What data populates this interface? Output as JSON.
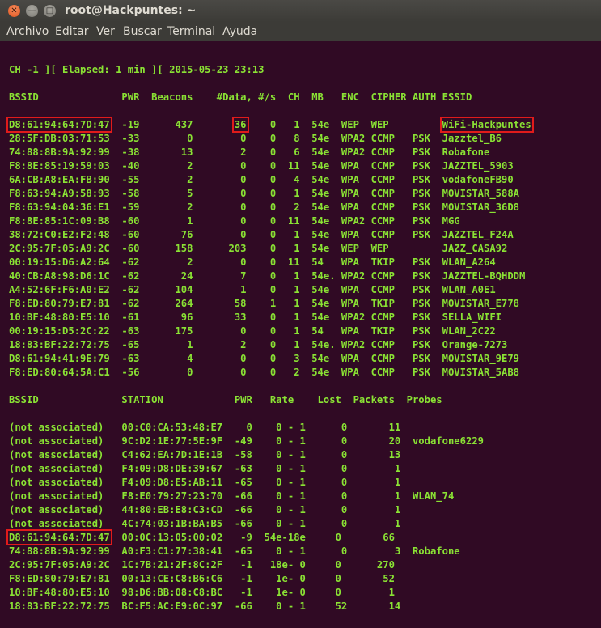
{
  "window": {
    "title": "root@Hackpuntes: ~",
    "close_glyph": "✕",
    "min_glyph": "—",
    "max_glyph": "□"
  },
  "menu": [
    "Archivo",
    "Editar",
    "Ver",
    "Buscar",
    "Terminal",
    "Ayuda"
  ],
  "colors": {
    "terminal_bg": "#300a24",
    "terminal_text": "#8ae234",
    "highlight_box": "#e01b1b"
  },
  "terminal": {
    "lines": [
      "",
      "CH -1 ][ Elapsed: 1 min ][ 2015-05-23 23:13",
      "",
      "BSSID              PWR  Beacons    #Data, #/s  CH  MB   ENC  CIPHER AUTH ESSID",
      "",
      "D8:61:94:64:7D:47  -19      437       36    0   1  54e  WEP  WEP         WiFi-Hackpuntes",
      "28:5F:DB:03:71:53  -33        0        0    0   8  54e  WPA2 CCMP   PSK  Jazztel_B6",
      "74:88:8B:9A:92:99  -38       13        2    0   6  54e  WPA2 CCMP   PSK  Robafone",
      "F8:8E:85:19:59:03  -40        2        0    0  11  54e  WPA  CCMP   PSK  JAZZTEL_5903",
      "6A:CB:A8:EA:FB:90  -55        2        0    0   4  54e  WPA  CCMP   PSK  vodafoneFB90",
      "F8:63:94:A9:58:93  -58        5        0    0   1  54e  WPA  CCMP   PSK  MOVISTAR_588A",
      "F8:63:94:04:36:E1  -59        2        0    0   2  54e  WPA  CCMP   PSK  MOVISTAR_36D8",
      "F8:8E:85:1C:09:B8  -60        1        0    0  11  54e  WPA2 CCMP   PSK  MGG",
      "38:72:C0:E2:F2:48  -60       76        0    0   1  54e  WPA  CCMP   PSK  JAZZTEL_F24A",
      "2C:95:7F:05:A9:2C  -60      158      203    0   1  54e  WEP  WEP         JAZZ_CASA92",
      "00:19:15:D6:A2:64  -62        2        0    0  11  54   WPA  TKIP   PSK  WLAN_A264",
      "40:CB:A8:98:D6:1C  -62       24        7    0   1  54e. WPA2 CCMP   PSK  JAZZTEL-BQHDDM",
      "A4:52:6F:F6:A0:E2  -62      104        1    0   1  54e  WPA  CCMP   PSK  WLAN_A0E1",
      "F8:ED:80:79:E7:81  -62      264       58    1   1  54e  WPA  TKIP   PSK  MOVISTAR_E778",
      "10:BF:48:80:E5:10  -61       96       33    0   1  54e  WPA2 CCMP   PSK  SELLA_WIFI",
      "00:19:15:D5:2C:22  -63      175        0    0   1  54   WPA  TKIP   PSK  WLAN_2C22",
      "18:83:BF:22:72:75  -65        1        2    0   1  54e. WPA2 CCMP   PSK  Orange-7273",
      "D8:61:94:41:9E:79  -63        4        0    0   3  54e  WPA  CCMP   PSK  MOVISTAR_9E79",
      "F8:ED:80:64:5A:C1  -56        0        0    0   2  54e  WPA  CCMP   PSK  MOVISTAR_5AB8",
      "",
      "BSSID              STATION            PWR   Rate    Lost  Packets  Probes",
      "",
      "(not associated)   00:C0:CA:53:48:E7    0    0 - 1      0       11",
      "(not associated)   9C:D2:1E:77:5E:9F  -49    0 - 1      0       20  vodafone6229",
      "(not associated)   C4:62:EA:7D:1E:1B  -58    0 - 1      0       13",
      "(not associated)   F4:09:D8:DE:39:67  -63    0 - 1      0        1",
      "(not associated)   F4:09:D8:E5:AB:11  -65    0 - 1      0        1",
      "(not associated)   F8:E0:79:27:23:70  -66    0 - 1      0        1  WLAN_74",
      "(not associated)   44:80:EB:E8:C3:CD  -66    0 - 1      0        1",
      "(not associated)   4C:74:03:1B:BA:B5  -66    0 - 1      0        1",
      "D8:61:94:64:7D:47  00:0C:13:05:00:02   -9  54e-18e     0       66",
      "74:88:8B:9A:92:99  A0:F3:C1:77:38:41  -65    0 - 1      0        3  Robafone",
      "2C:95:7F:05:A9:2C  1C:7B:21:2F:8C:2F   -1   18e- 0     0      270",
      "F8:ED:80:79:E7:81  00:13:CE:C8:B6:C6   -1    1e- 0     0       52",
      "10:BF:48:80:E5:10  98:D6:BB:08:C8:BC   -1    1e- 0     0        1",
      "18:83:BF:22:72:75  BC:F5:AC:E9:0C:97  -66    0 - 1     52       14"
    ],
    "highlights": [
      {
        "line": 5,
        "text": "D8:61:94:64:7D:47"
      },
      {
        "line": 5,
        "text": "36"
      },
      {
        "line": 5,
        "text": "1",
        "occurrence": 2
      },
      {
        "line": 5,
        "text": "WiFi-Hackpuntes"
      },
      {
        "line": 35,
        "text": "D8:61:94:64:7D:47"
      }
    ]
  }
}
